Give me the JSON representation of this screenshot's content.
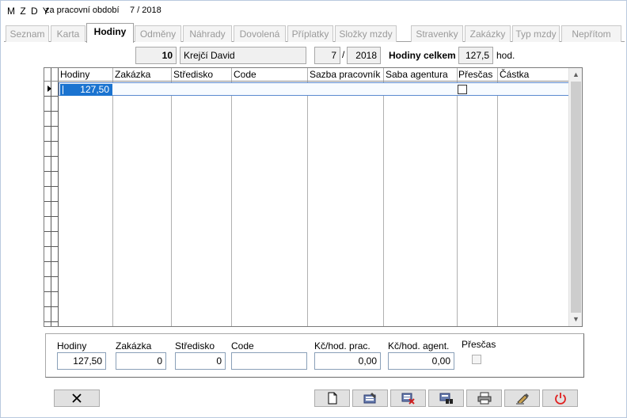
{
  "title": {
    "app": "M Z D Y",
    "sub": "za pracovní období",
    "period": "7 / 2018"
  },
  "tabs": [
    {
      "label": "Seznam",
      "active": false
    },
    {
      "label": "Karta",
      "active": false
    },
    {
      "label": "Hodiny",
      "active": true
    },
    {
      "label": "Odměny",
      "active": false
    },
    {
      "label": "Náhrady",
      "active": false
    },
    {
      "label": "Dovolená",
      "active": false
    },
    {
      "label": "Příplatky",
      "active": false
    },
    {
      "label": "Složky mzdy",
      "active": false
    },
    {
      "label": "Stravenky",
      "active": false
    },
    {
      "label": "Zakázky",
      "active": false
    },
    {
      "label": "Typ mzdy",
      "active": false
    },
    {
      "label": "Nepřítom",
      "active": false
    }
  ],
  "header": {
    "employee_id": "10",
    "employee_name": "Krejčí David",
    "month": "7",
    "slash": "/",
    "year": "2018",
    "total_label": "Hodiny celkem",
    "total_value": "127,5",
    "unit": "hod."
  },
  "grid": {
    "columns": [
      "Hodiny",
      "Zakázka",
      "Středisko",
      "Code",
      "Sazba pracovník",
      "Saba agentura",
      "Přesčas",
      "Částka"
    ],
    "rows": [
      {
        "hodiny": "127,50",
        "zakazka": "",
        "stredisko": "",
        "code": "",
        "sazba_pracovnik": "",
        "saba_agentura": "",
        "prescas": false,
        "castka": ""
      }
    ]
  },
  "detail": {
    "labels": {
      "hodiny": "Hodiny",
      "zakazka": "Zakázka",
      "stredisko": "Středisko",
      "code": "Code",
      "kc_prac": "Kč/hod. prac.",
      "kc_agent": "Kč/hod. agent.",
      "prescas": "Přesčas"
    },
    "values": {
      "hodiny": "127,50",
      "zakazka": "0",
      "stredisko": "0",
      "code": "",
      "kc_prac": "0,00",
      "kc_agent": "0,00"
    }
  },
  "buttons": {
    "close_icon": "x-icon",
    "actions": [
      "new-document-icon",
      "edit-icon",
      "delete-icon",
      "find-icon",
      "print-icon",
      "pencil-tool-icon",
      "power-icon"
    ],
    "colors": {
      "delete_red": "#d02020",
      "power_red": "#e02020",
      "accent_blue": "#1a73d0"
    }
  }
}
